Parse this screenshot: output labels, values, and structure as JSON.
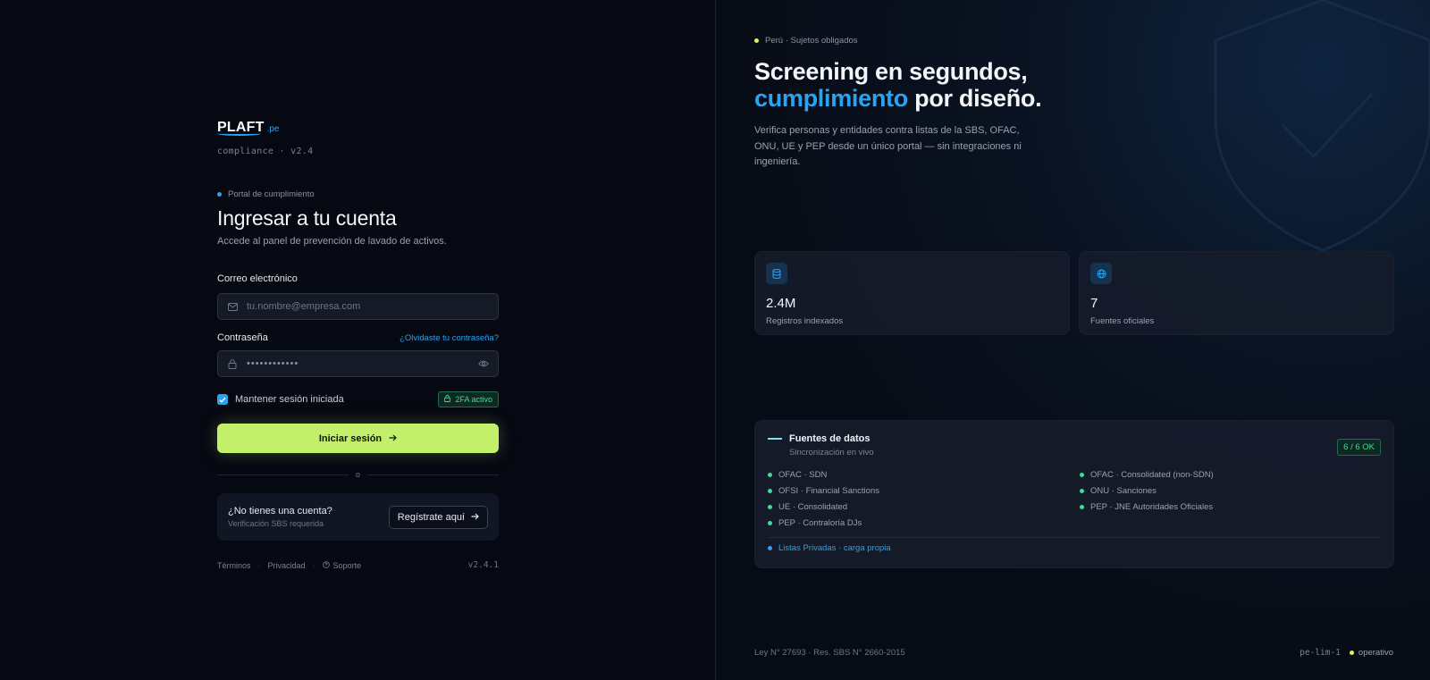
{
  "brand": {
    "name": "PLAFT",
    "tld": ".pe",
    "tagline": "compliance · v2.4"
  },
  "login": {
    "eyebrow": "Portal de cumplimiento",
    "title": "Ingresar a tu cuenta",
    "subtitle": "Accede al panel de prevención de lavado de activos.",
    "email_label": "Correo electrónico",
    "email_placeholder": "tu.nombre@empresa.com",
    "password_label": "Contraseña",
    "forgot_link": "¿Olvidaste tu contraseña?",
    "password_mask": "••••••••••••",
    "remember_label": "Mantener sesión iniciada",
    "remember_checked": true,
    "twofa_badge": "2FA activo",
    "submit_label": "Iniciar sesión",
    "divider_text": "o",
    "register_question": "¿No tienes una cuenta?",
    "register_note": "Verificación SBS requerida",
    "register_button": "Regístrate aquí"
  },
  "left_footer": {
    "terms": "Términos",
    "privacy": "Privacidad",
    "support": "Soporte",
    "version": "v2.4.1"
  },
  "hero": {
    "eyebrow": "Perú · Sujetos obligados",
    "line1": "Screening en segundos,",
    "accent": "cumplimiento",
    "line2_rest": " por diseño.",
    "description": "Verifica personas y entidades contra listas de la SBS, OFAC, ONU, UE y PEP desde un único portal — sin integraciones ni ingeniería."
  },
  "stats": [
    {
      "icon": "database-icon",
      "value": "2.4M",
      "label": "Registros indexados"
    },
    {
      "icon": "globe-icon",
      "value": "7",
      "label": "Fuentes oficiales"
    }
  ],
  "sources": {
    "title": "Fuentes de datos",
    "subtitle": "Sincronización en vivo",
    "status_badge": "6 / 6 OK",
    "items": [
      "OFAC · SDN",
      "OFAC · Consolidated (non-SDN)",
      "OFSI · Financial Sanctions",
      "ONU · Sanciones",
      "UE · Consolidated",
      "PEP · JNE Autoridades Oficiales",
      "PEP · Contraloría DJs"
    ],
    "private_lists": "Listas Privadas · carga propia"
  },
  "right_footer": {
    "law": "Ley N° 27693 · Res. SBS N° 2660-2015",
    "node": "pe-lim-1",
    "status": "operativo"
  },
  "colors": {
    "accent_blue": "#2aa3f0",
    "primary_green": "#c3f06a",
    "ok_green": "#3ddc97",
    "status_yellow": "#d8f26a"
  }
}
